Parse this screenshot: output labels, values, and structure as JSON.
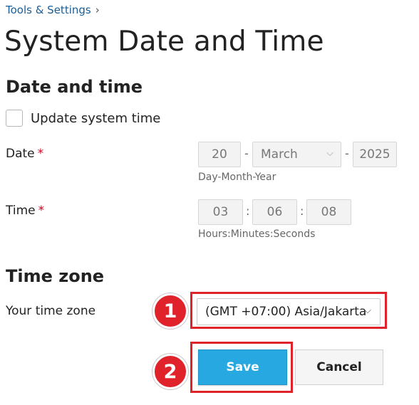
{
  "breadcrumb": {
    "label": "Tools & Settings",
    "chevron": "›"
  },
  "page": {
    "title": "System Date and Time"
  },
  "date_time_section": {
    "title": "Date and time",
    "update_checkbox": {
      "label": "Update system time",
      "checked": false
    },
    "date": {
      "label": "Date",
      "required_mark": "*",
      "day": "20",
      "month": "March",
      "year": "2025",
      "separator": "-",
      "hint": "Day-Month-Year"
    },
    "time": {
      "label": "Time",
      "required_mark": "*",
      "hours": "03",
      "minutes": "06",
      "seconds": "08",
      "separator": ":",
      "hint": "Hours:Minutes:Seconds"
    }
  },
  "time_zone_section": {
    "title": "Time zone",
    "label": "Your time zone",
    "selected": "(GMT +07:00) Asia/Jakarta"
  },
  "actions": {
    "save_label": "Save",
    "cancel_label": "Cancel"
  },
  "annotations": {
    "step1": "1",
    "step2": "2"
  },
  "colors": {
    "accent": "#28a8e0",
    "highlight": "#e0232b",
    "link": "#1a5e96"
  }
}
